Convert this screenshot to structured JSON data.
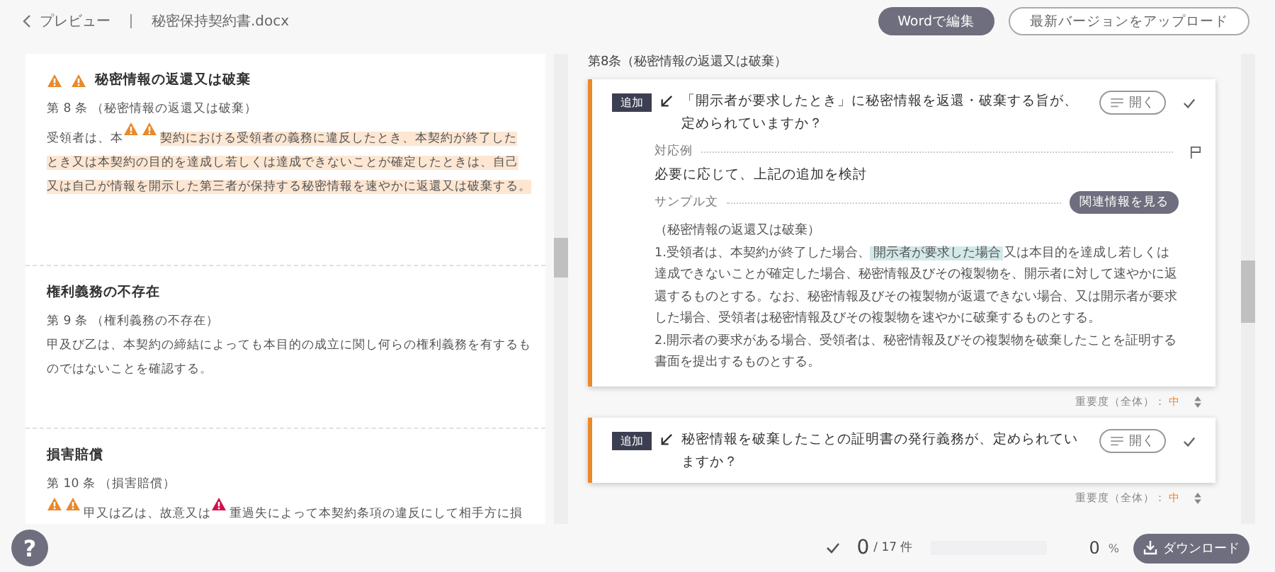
{
  "header": {
    "back_label": "プレビュー",
    "file_name": "秘密保持契約書.docx",
    "buttons": [
      {
        "label": "Wordで編集",
        "kind": "primary"
      },
      {
        "label": "最新バージョンをアップロード",
        "kind": "outline"
      }
    ]
  },
  "document": {
    "sections": [
      {
        "title": "秘密情報の返還又は破棄",
        "title_warnings": [
          {
            "color": "#e8892b"
          },
          {
            "color": "#e8892b"
          }
        ],
        "heading": "第 8 条 （秘密情報の返還又は破棄）",
        "body": [
          {
            "kind": "text",
            "text": "受領者は、本"
          },
          {
            "kind": "warning",
            "color": "#e8892b"
          },
          {
            "kind": "warning",
            "color": "#e8892b"
          },
          {
            "kind": "highlight",
            "text": "契約における受領者の義務に違反したとき、本契約が終了した"
          },
          {
            "kind": "highlight",
            "text": "とき又は本契約の目的を達成し若しくは達成できないことが確定したときは、自己"
          },
          {
            "kind": "highlight",
            "text": "又は自己が情報を開示した第三者が保持する秘密情報を速やかに返還又は破棄す"
          },
          {
            "kind": "highlight",
            "text": "る。"
          }
        ]
      },
      {
        "title": "権利義務の不存在",
        "heading": "第 9 条 （権利義務の不存在）",
        "body": [
          {
            "kind": "text",
            "text": "甲及び乙は、本契約の締結によっても本目的の成立に関し何らの権利義務を有するものではないことを確認する。"
          }
        ]
      },
      {
        "title": "損害賠償",
        "heading": "第 10 条 （損害賠償）",
        "body": [
          {
            "kind": "warning",
            "color": "#e8892b"
          },
          {
            "kind": "warning",
            "color": "#e8892b"
          },
          {
            "kind": "text",
            "text": "甲又は乙は、故意又は"
          },
          {
            "kind": "warning",
            "color": "#d0104c"
          },
          {
            "kind": "text",
            "text": "重過失によって本契約条項の違反にして相手方に損"
          }
        ]
      }
    ]
  },
  "review": {
    "section_title": "第8条（秘密情報の返還又は破棄）",
    "items": [
      {
        "tag": "追加",
        "question": "「開示者が要求したとき」に秘密情報を返還・破棄する旨が、定められていますか？",
        "open_label": "開く",
        "checked": false,
        "expanded": true,
        "response_label": "対応例",
        "response": "必要に応じて、上記の追加を検討",
        "sample_label": "サンプル文",
        "related_button": "関連情報を見る",
        "sample": [
          [
            {
              "kind": "text",
              "text": "（秘密情報の返還又は破棄）"
            }
          ],
          [
            {
              "kind": "text",
              "text": "1.受領者は、本契約が終了した場合、"
            },
            {
              "kind": "highlight",
              "text": "開示者が要求した場合"
            },
            {
              "kind": "text",
              "text": "又は本目的を達成し若しくは達成できないことが確定した場合、秘密情報及びその複製物を、開示者に対して速やかに返還するものとする。なお、秘密情報及びその複製物が返還できない場合、又は開示者が要求した場合、受領者は秘密情報及びその複製物を速やかに破棄するものとする。"
            }
          ],
          [
            {
              "kind": "text",
              "text": "2.開示者の要求がある場合、受領者は、秘密情報及びその複製物を破棄したことを証明する書面を提出するものとする。"
            }
          ]
        ],
        "importance_label": "重要度（全体）：",
        "importance": "中"
      },
      {
        "tag": "追加",
        "question": "秘密情報を破棄したことの証明書の発行義務が、定められていますか？",
        "open_label": "開く",
        "checked": false,
        "expanded": false,
        "importance_label": "重要度（全体）：",
        "importance": "中"
      }
    ]
  },
  "footer": {
    "help_label": "?",
    "done": "0",
    "total": "/ 17 件",
    "level": 0,
    "percent": "0",
    "percent_unit": "%",
    "download_label": "ダウンロード"
  }
}
